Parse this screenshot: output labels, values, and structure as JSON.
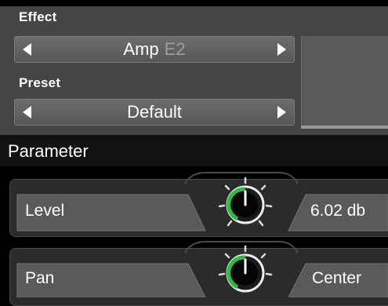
{
  "effect": {
    "label": "Effect",
    "value": "Amp",
    "value_suffix": "E2"
  },
  "preset": {
    "label": "Preset",
    "value": "Default"
  },
  "parameter": {
    "title": "Parameter",
    "rows": [
      {
        "label": "Level",
        "value": "6.02 db",
        "knob_level": 0.5
      },
      {
        "label": "Pan",
        "value": "Center",
        "knob_level": 0.5
      }
    ]
  },
  "colors": {
    "panel": "#454545",
    "header_bar": "#111111",
    "knob_ring": "#36b54a",
    "text": "#ffffff",
    "muted_text": "#9e9e9e"
  },
  "icons": {
    "left": "triangle-left-icon",
    "right": "triangle-right-icon",
    "knob": "knob-icon"
  }
}
